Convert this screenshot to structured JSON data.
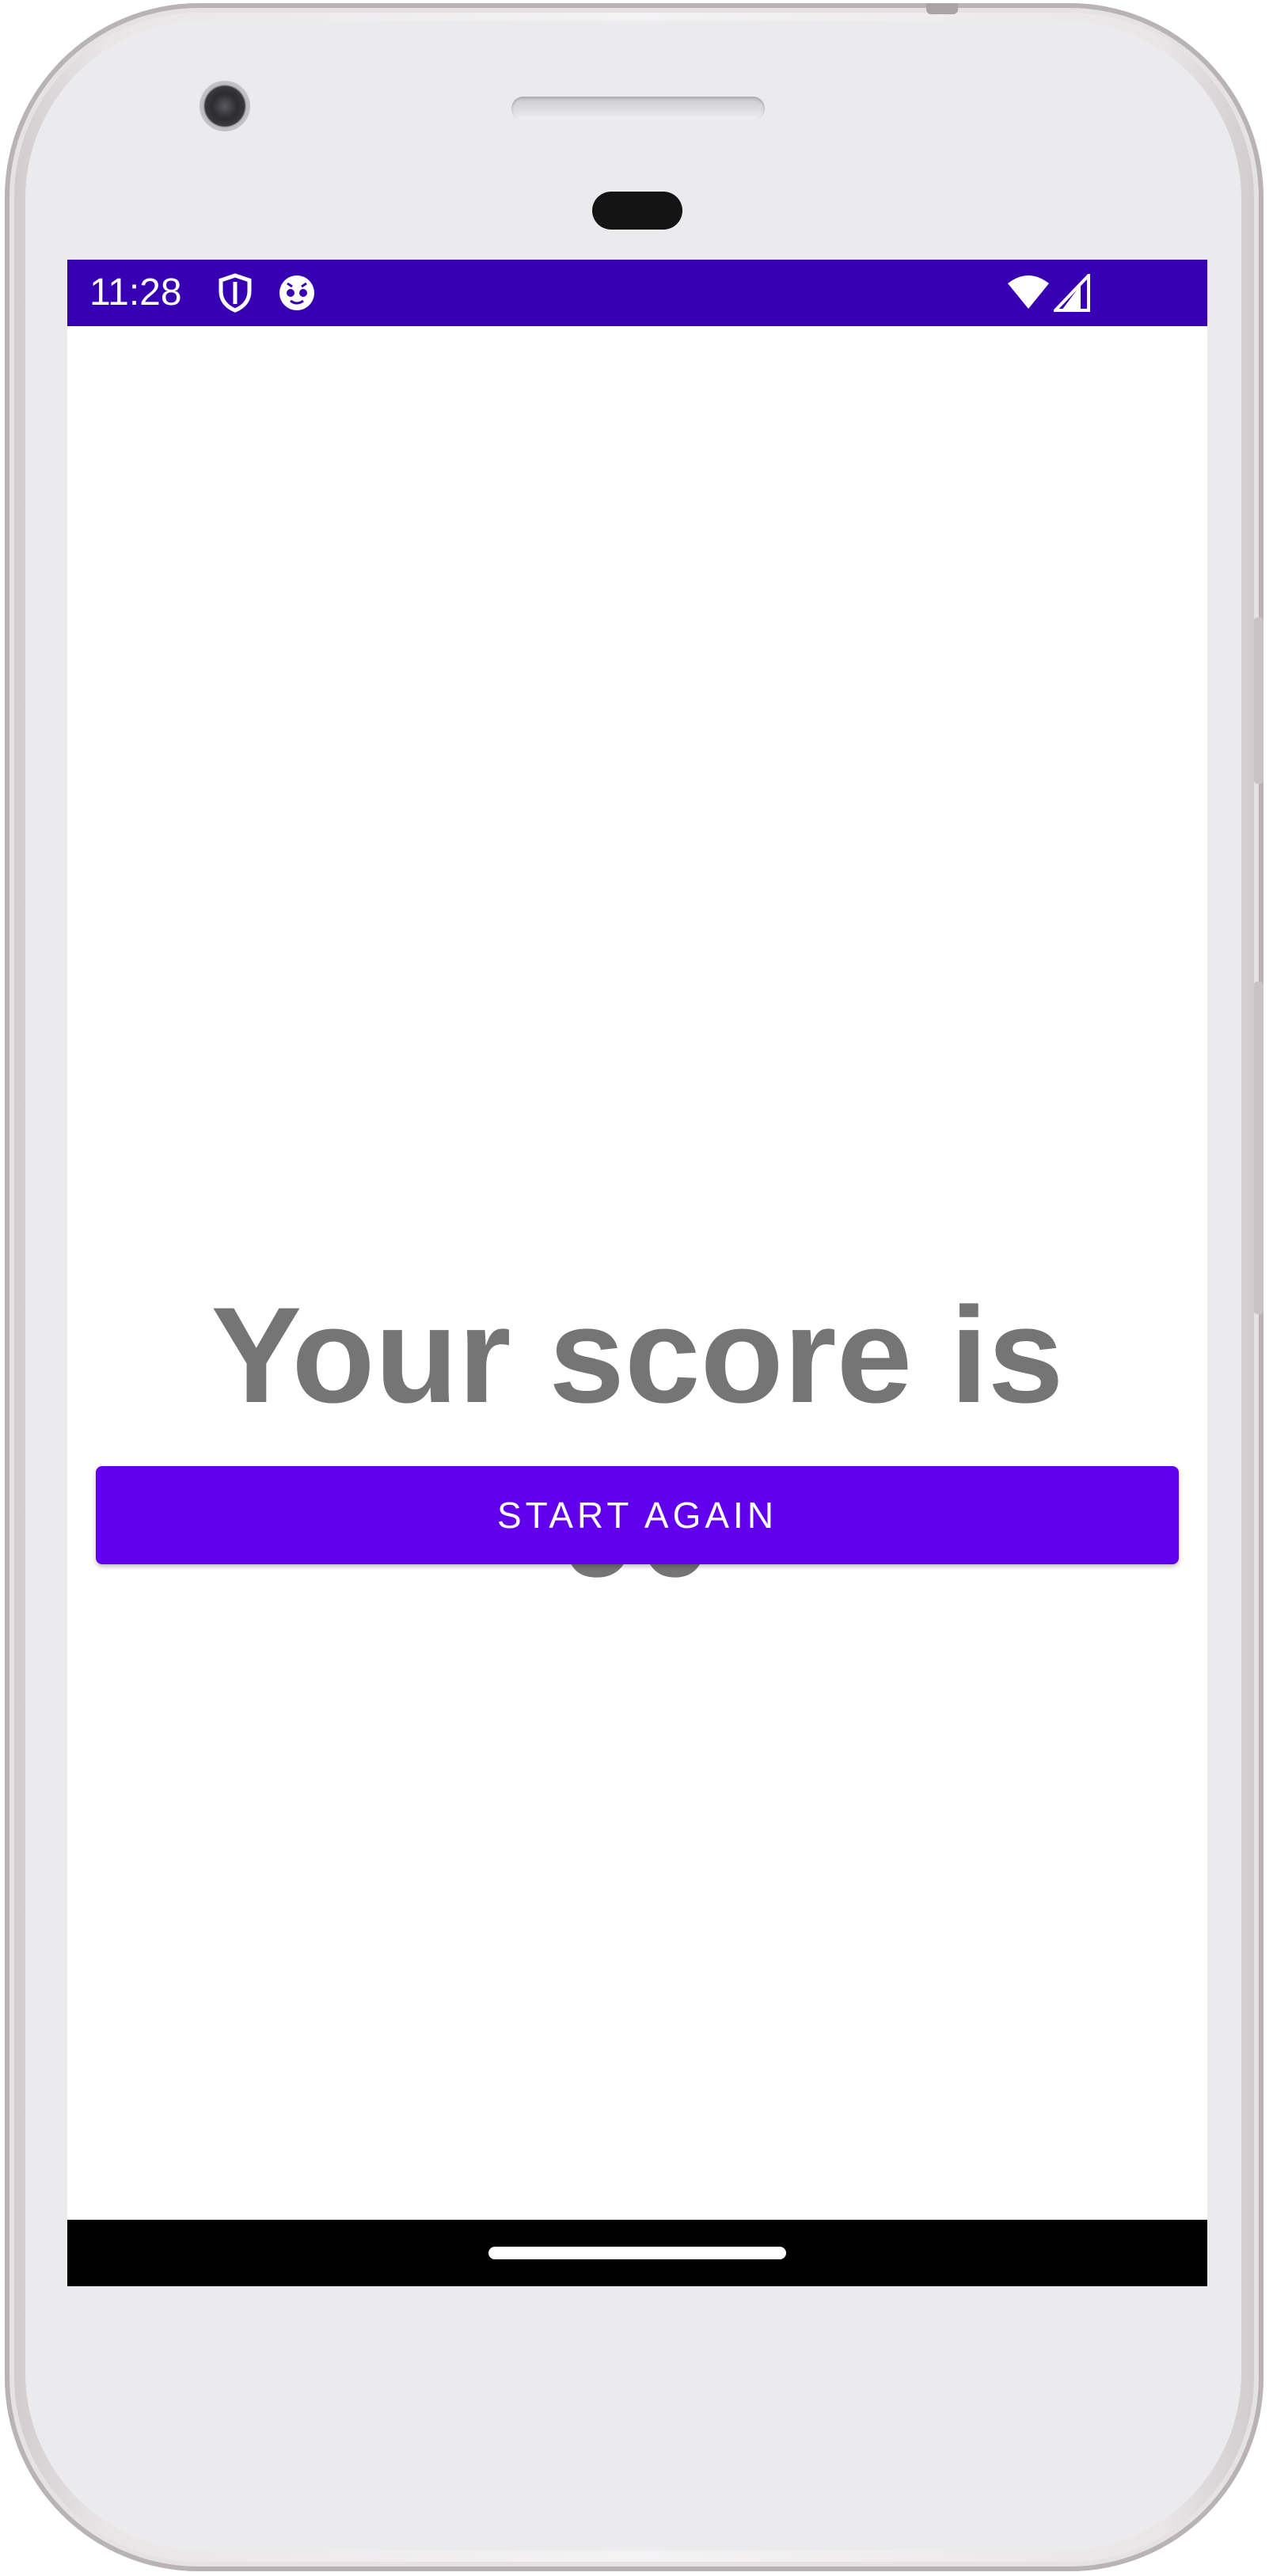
{
  "status_bar": {
    "time": "11:28",
    "background_color": "#3700b3",
    "icons": [
      "shield-icon",
      "app-notification-icon",
      "wifi-icon",
      "cellular-signal-icon"
    ]
  },
  "main": {
    "score_text": "Your score is 90",
    "text_color": "#757575"
  },
  "actions": {
    "start_again_label": "START AGAIN",
    "button_color": "#6200ee"
  },
  "nav_bar": {
    "background_color": "#000000",
    "handle": "home-handle"
  }
}
